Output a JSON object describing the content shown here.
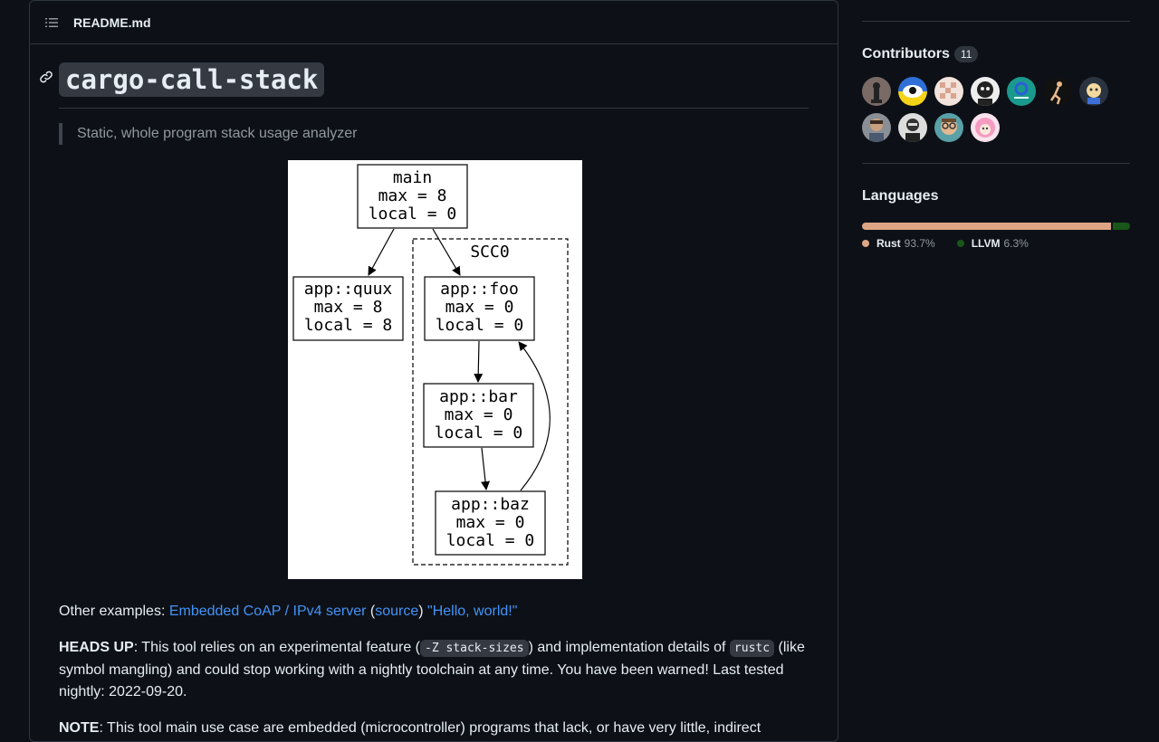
{
  "readme": {
    "filename": "README.md",
    "title": "cargo-call-stack",
    "tagline": "Static, whole program stack usage analyzer",
    "diagram": {
      "nodes": [
        {
          "l1": "main",
          "l2": "max = 8",
          "l3": "local = 0"
        },
        {
          "l1": "app::quux",
          "l2": "max = 8",
          "l3": "local = 8"
        },
        {
          "l1": "app::foo",
          "l2": "max = 0",
          "l3": "local = 0"
        },
        {
          "l1": "app::bar",
          "l2": "max = 0",
          "l3": "local = 0"
        },
        {
          "l1": "app::baz",
          "l2": "max = 0",
          "l3": "local = 0"
        }
      ],
      "cluster_label": "SCC0"
    },
    "examples": {
      "prefix": "Other examples: ",
      "link1": "Embedded CoAP / IPv4 server",
      "open_paren": " (",
      "link2": "source",
      "close_paren": ") ",
      "link3": "\"Hello, world!\""
    },
    "heads_up": {
      "label": "HEADS UP",
      "text1": ": This tool relies on an experimental feature (",
      "code1": "-Z stack-sizes",
      "text2": ") and implementation details of ",
      "code2": "rustc",
      "text3": " (like symbol mangling) and could stop working with a nightly toolchain at any time. You have been warned! Last tested nightly: 2022-09-20."
    },
    "note": {
      "label": "NOTE",
      "text": ": This tool main use case are embedded (microcontroller) programs that lack, or have very little, indirect"
    }
  },
  "sidebar": {
    "contributors": {
      "title": "Contributors",
      "count": "11",
      "avatars": [
        {
          "icon": "avatar-chess-icon"
        },
        {
          "icon": "avatar-eye-icon"
        },
        {
          "icon": "avatar-pattern-icon"
        },
        {
          "icon": "avatar-portrait-icon"
        },
        {
          "icon": "avatar-ie-icon"
        },
        {
          "icon": "avatar-runner-icon"
        },
        {
          "icon": "avatar-cartoon-icon"
        },
        {
          "icon": "avatar-person-icon"
        },
        {
          "icon": "avatar-bw-icon"
        },
        {
          "icon": "avatar-glasses-icon"
        },
        {
          "icon": "avatar-anime-icon"
        }
      ]
    },
    "languages": {
      "title": "Languages",
      "items": [
        {
          "name": "Rust",
          "percent": "93.7%",
          "value": 93.7,
          "color": "#dea584"
        },
        {
          "name": "LLVM",
          "percent": "6.3%",
          "value": 6.3,
          "color": "#185619"
        }
      ]
    }
  }
}
